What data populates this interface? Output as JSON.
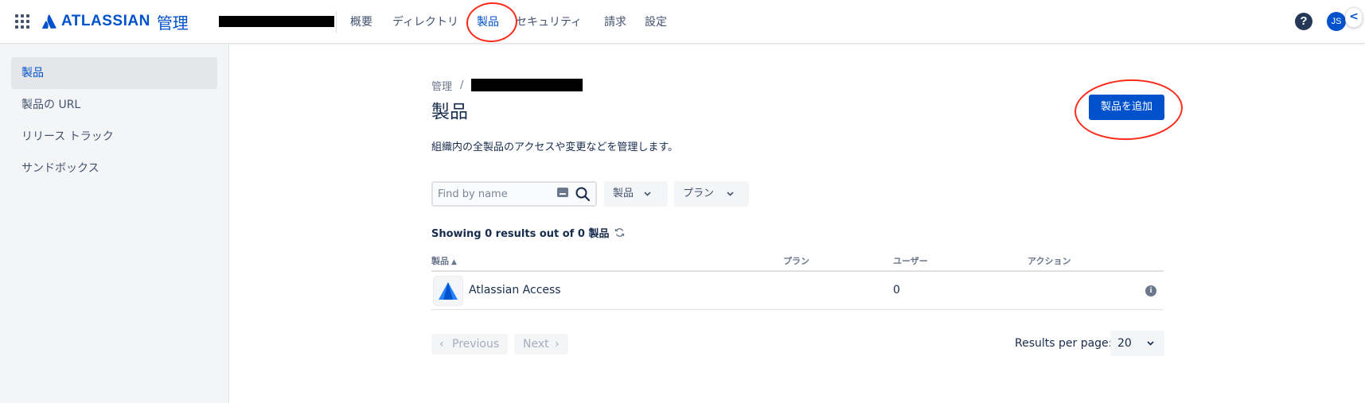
{
  "topbar": {
    "logo_text": "ATLASSIAN",
    "logo_suffix": "管理",
    "nav": [
      "概要",
      "ディレクトリ",
      "製品",
      "セキュリティ",
      "請求",
      "設定"
    ],
    "active_nav": "製品",
    "help_symbol": "?",
    "avatar_initials": "JS",
    "collapse_symbol": "<"
  },
  "sidebar": {
    "items": [
      "製品",
      "製品の URL",
      "リリース トラック",
      "サンドボックス"
    ],
    "active": "製品"
  },
  "main": {
    "breadcrumb_root": "管理",
    "breadcrumb_sep": "/",
    "title": "製品",
    "add_button": "製品を追加",
    "description": "組織内の全製品のアクセスや変更などを管理します。",
    "search_placeholder": "Find by name",
    "filters": [
      "製品",
      "プラン"
    ],
    "results_text": "Showing 0 results out of 0 製品",
    "columns": [
      "製品",
      "プラン",
      "ユーザー",
      "アクション"
    ],
    "sort_indicator": "▲",
    "rows": [
      {
        "product": "Atlassian Access",
        "plan": "",
        "users": "0"
      }
    ],
    "info_symbol": "i",
    "pagination": {
      "previous": "Previous",
      "next": "Next"
    },
    "results_per_page_label": "Results per page:",
    "results_per_page_value": "20"
  },
  "colors": {
    "brand": "#0052cc",
    "annotation": "#ff2a1a"
  }
}
